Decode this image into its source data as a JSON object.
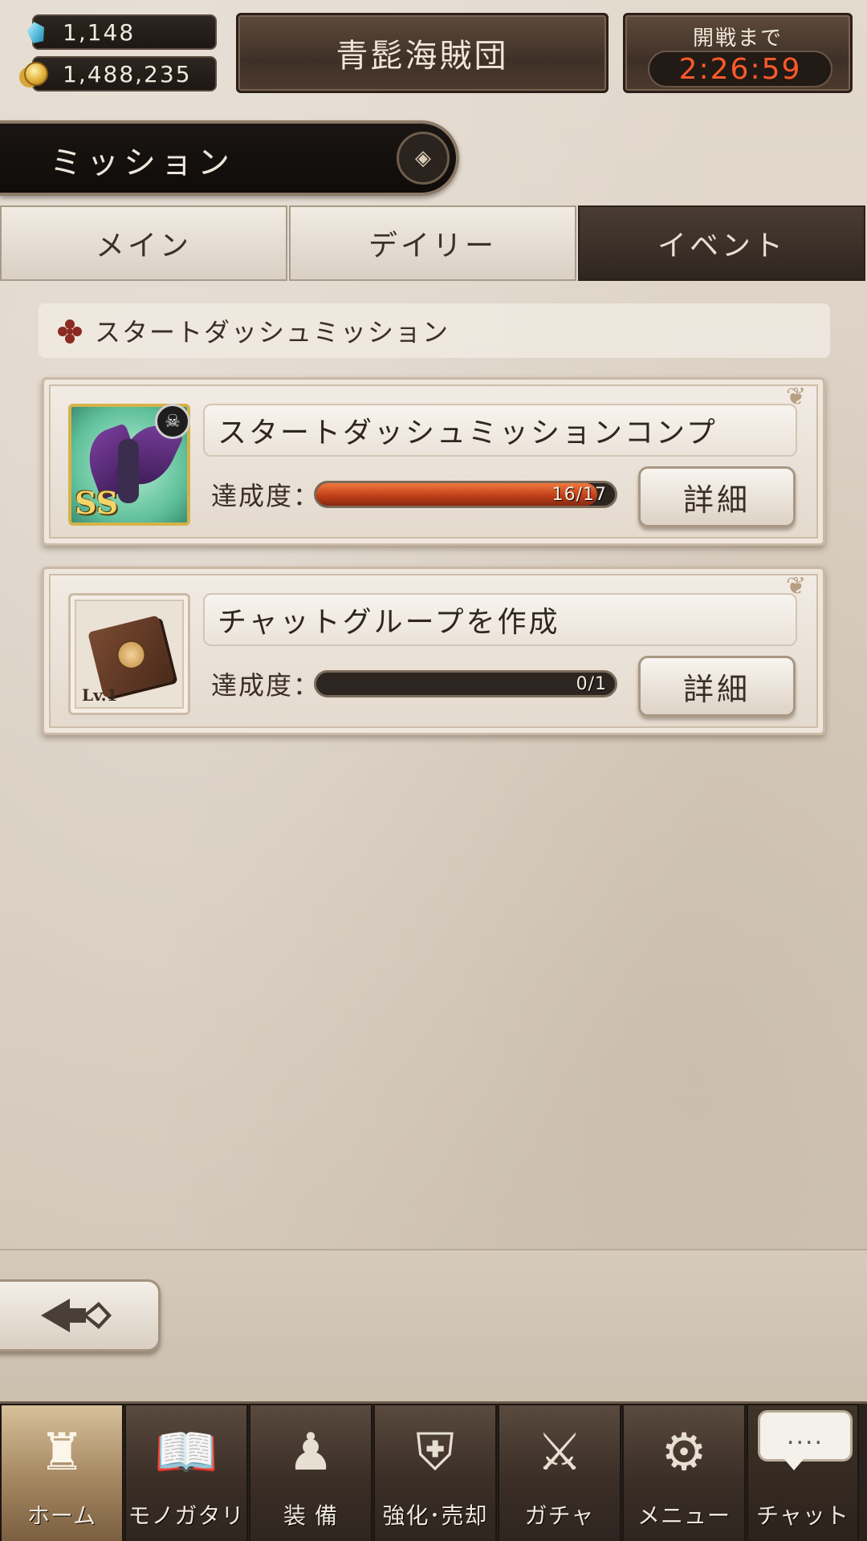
{
  "status": {
    "gems": "1,148",
    "coins": "1,488,235",
    "guild_name": "青髭海賊団",
    "timer_label": "開戦まで",
    "timer_value": "2:26:59"
  },
  "header": {
    "title": "ミッション"
  },
  "tabs": [
    {
      "label": "メイン",
      "active": false
    },
    {
      "label": "デイリー",
      "active": false
    },
    {
      "label": "イベント",
      "active": true
    }
  ],
  "section": {
    "title": "スタートダッシュミッション"
  },
  "missions": [
    {
      "title": "スタートダッシュミッションコンプ",
      "progress_label": "達成度：",
      "progress_text": "16/17",
      "progress_fraction": 0.94,
      "detail_label": "詳細",
      "rank": "SS"
    },
    {
      "title": "チャットグループを作成",
      "progress_label": "達成度：",
      "progress_text": "0/1",
      "progress_fraction": 0.0,
      "detail_label": "詳細",
      "level": "Lv.1"
    }
  ],
  "nav": [
    {
      "label": "ホーム",
      "icon": "castle-icon",
      "active": true
    },
    {
      "label": "モノガタリ",
      "icon": "book-icon",
      "active": false
    },
    {
      "label": "装 備",
      "icon": "puppet-icon",
      "active": false
    },
    {
      "label": "強化･売却",
      "icon": "shield-icon",
      "active": false
    },
    {
      "label": "ガチャ",
      "icon": "swords-icon",
      "active": false
    },
    {
      "label": "メニュー",
      "icon": "gear-icon",
      "active": false
    },
    {
      "label": "チャット",
      "icon": "chat-icon",
      "active": false
    }
  ],
  "chat_bubble": "....",
  "colors": {
    "timer": "#ff5a2a",
    "progress_fill": "#c0401a",
    "active_tab": "#3a2e26",
    "active_nav": "#a48660"
  }
}
